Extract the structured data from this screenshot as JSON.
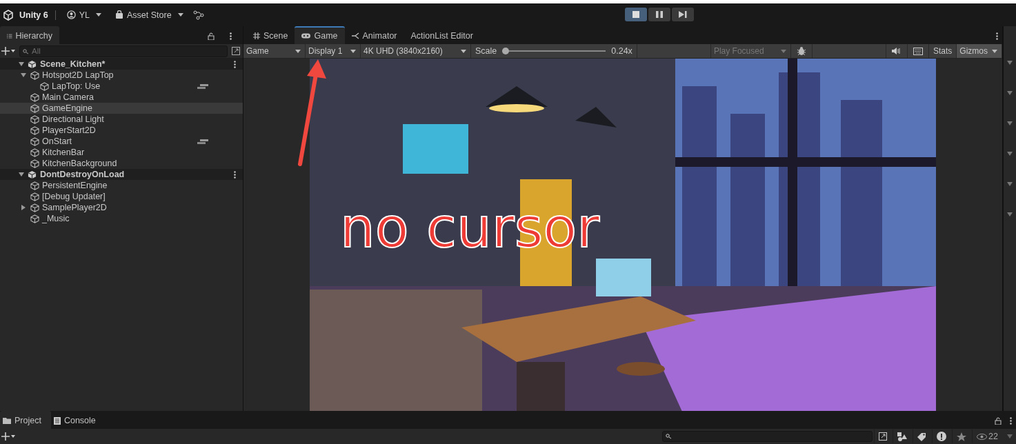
{
  "toolbar": {
    "product": "Unity 6",
    "account": "YL",
    "store": "Asset Store",
    "play_controls": [
      {
        "kind": "play",
        "selected": true
      },
      {
        "kind": "pause",
        "selected": false
      },
      {
        "kind": "step",
        "selected": false
      }
    ]
  },
  "hierarchy": {
    "tab": "Hierarchy",
    "search": {
      "placeholder": "All"
    },
    "scenes": [
      {
        "name": "Scene_Kitchen*",
        "expanded": true,
        "children": [
          {
            "name": "Hotspot2D LapTop",
            "expanded": true,
            "selected": false,
            "marker": false,
            "children": [
              {
                "name": "LapTop: Use",
                "selected": false,
                "marker": true
              }
            ]
          },
          {
            "name": "Main Camera",
            "selected": false,
            "marker": false
          },
          {
            "name": "GameEngine",
            "selected": true,
            "marker": false
          },
          {
            "name": "Directional Light",
            "selected": false,
            "marker": false
          },
          {
            "name": "PlayerStart2D",
            "selected": false,
            "marker": false
          },
          {
            "name": "OnStart",
            "selected": false,
            "marker": true
          },
          {
            "name": "KitchenBar",
            "selected": false,
            "marker": false
          },
          {
            "name": "KitchenBackground",
            "selected": false,
            "marker": false
          }
        ]
      },
      {
        "name": "DontDestroyOnLoad",
        "expanded": true,
        "children": [
          {
            "name": "PersistentEngine",
            "selected": false,
            "marker": false
          },
          {
            "name": "[Debug Updater]",
            "selected": false,
            "marker": false
          },
          {
            "name": "SamplePlayer2D",
            "expanded": false,
            "selected": false,
            "marker": false
          },
          {
            "name": "_Music",
            "selected": false,
            "marker": false
          }
        ]
      }
    ]
  },
  "view_tabs": [
    {
      "label": "Scene",
      "kind": "scene",
      "selected": false
    },
    {
      "label": "Game",
      "kind": "game",
      "selected": true
    },
    {
      "label": "Animator",
      "kind": "animator",
      "selected": false
    },
    {
      "label": "ActionList Editor",
      "kind": "plain",
      "selected": false
    }
  ],
  "game_toolbar": {
    "view": "Game",
    "display": "Display 1",
    "resolution": "4K UHD (3840x2160)",
    "scale_label": "Scale",
    "scale": {
      "level": 0.0,
      "reading": "0.24x"
    },
    "play_mode": {
      "label": "Play Focused",
      "disabled": true
    },
    "stats": "Stats",
    "gizmos": "Gizmos"
  },
  "annotation": {
    "text": "no cursor"
  },
  "bottom_tabs": [
    {
      "label": "Project",
      "kind": "project",
      "selected": true
    },
    {
      "label": "Console",
      "kind": "console",
      "selected": false
    }
  ],
  "project": {
    "visible_count": "22"
  }
}
